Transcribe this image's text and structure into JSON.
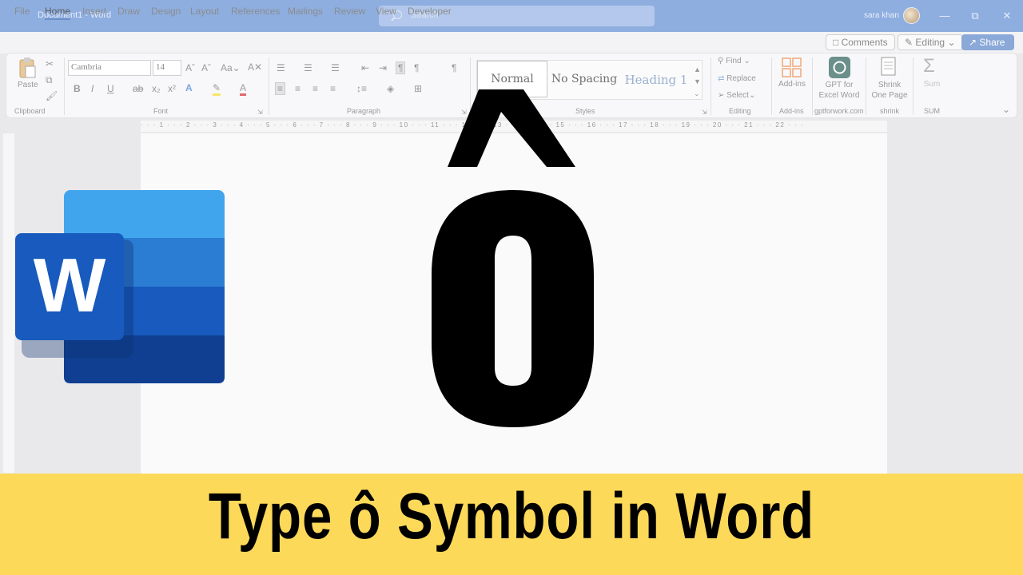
{
  "titlebar": {
    "doc_title": "Document1  -  Word",
    "search_placeholder": "Search",
    "user_name": "sara khan",
    "minimize": "—",
    "restore": "⧉",
    "close": "✕"
  },
  "menu": {
    "tabs": [
      "File",
      "Home",
      "Insert",
      "Draw",
      "Design",
      "Layout",
      "References",
      "Mailings",
      "Review",
      "View",
      "Developer"
    ],
    "comments": "Comments",
    "editing": "Editing",
    "share": "Share"
  },
  "ribbon": {
    "clipboard": {
      "paste": "Paste",
      "label": "Clipboard"
    },
    "font": {
      "name": "Cambria",
      "size": "14",
      "label": "Font"
    },
    "paragraph": {
      "label": "Paragraph"
    },
    "styles": {
      "items": [
        "Normal",
        "No Spacing",
        "Heading 1"
      ],
      "label": "Styles"
    },
    "editing": {
      "find": "Find",
      "replace": "Replace",
      "select": "Select",
      "label": "Editing"
    },
    "addins": {
      "button": "Add-ins",
      "label": "Add-ins"
    },
    "gpt": {
      "line1": "GPT for",
      "line2": "Excel Word",
      "label": "gptforwork.com"
    },
    "shrink": {
      "line1": "Shrink",
      "line2": "One Page",
      "label": "shrink"
    },
    "sum": {
      "button": "Sum",
      "label": "SUM"
    }
  },
  "ruler": {
    "numbers": "· · · 1 · · · 2 · · · 3 · · · 4 · · · 5 · · · 6 · · · 7 · · · 8 · · · 9 · · · 10 · · · 11 · · · 12 · · · 13 · · · 14 · · · 15 · · · 16 · · · 17 · · · 18 · · · 19 · · · 20 · · · 21 · · · 22 · · ·"
  },
  "logo": {
    "letter": "W"
  },
  "banner": {
    "title": "Type ô Symbol in Word"
  },
  "colors": {
    "titlebar": "#8eaee0",
    "banner": "#fcd959",
    "word_blue_1": "#41a5ee",
    "word_blue_2": "#2b7cd3",
    "word_blue_3": "#185abd",
    "word_blue_4": "#103f91"
  }
}
